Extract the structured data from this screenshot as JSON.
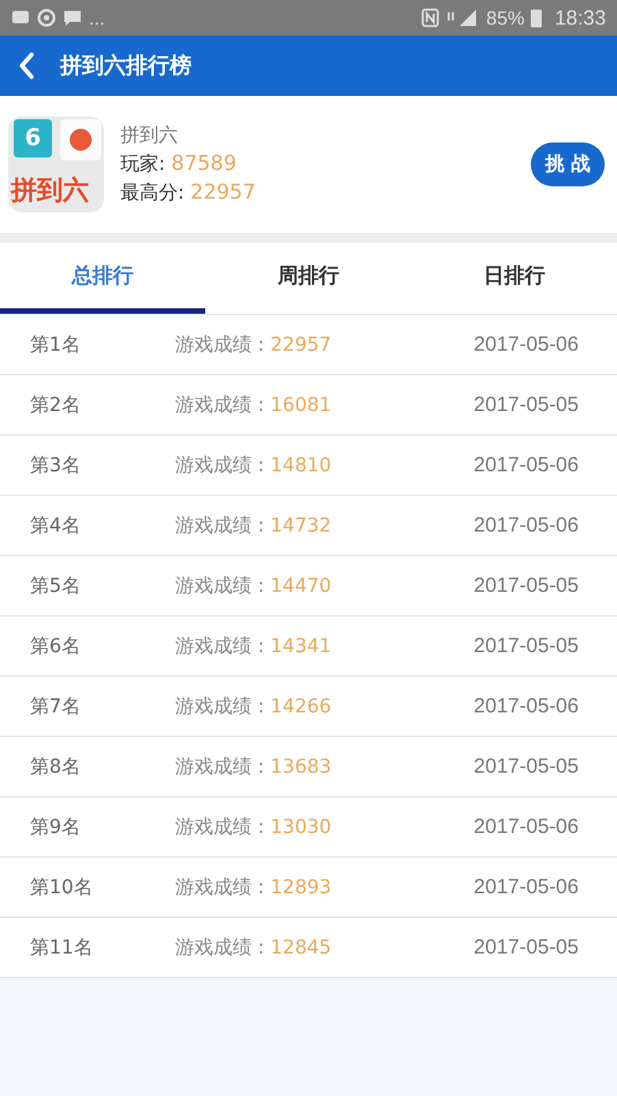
{
  "status_bar": {
    "more": "...",
    "battery": "85%",
    "time": "18:33"
  },
  "header": {
    "title": "拼到六排行榜"
  },
  "game": {
    "icon_number": "6",
    "icon_title": "拼到六",
    "name": "拼到六",
    "players_label": "玩家: ",
    "players": "87589",
    "best_label": "最高分: ",
    "best": "22957",
    "button": "挑 战"
  },
  "tabs": [
    {
      "label": "总排行",
      "selected": true
    },
    {
      "label": "周排行",
      "selected": false
    },
    {
      "label": "日排行",
      "selected": false
    }
  ],
  "rows": [
    {
      "rank": "第1名",
      "label": "游戏成绩 : ",
      "score": "22957",
      "date": "2017-05-06"
    },
    {
      "rank": "第2名",
      "label": "游戏成绩 : ",
      "score": "16081",
      "date": "2017-05-05"
    },
    {
      "rank": "第3名",
      "label": "游戏成绩 : ",
      "score": "14810",
      "date": "2017-05-06"
    },
    {
      "rank": "第4名",
      "label": "游戏成绩 : ",
      "score": "14732",
      "date": "2017-05-06"
    },
    {
      "rank": "第5名",
      "label": "游戏成绩 : ",
      "score": "14470",
      "date": "2017-05-05"
    },
    {
      "rank": "第6名",
      "label": "游戏成绩 : ",
      "score": "14341",
      "date": "2017-05-05"
    },
    {
      "rank": "第7名",
      "label": "游戏成绩 : ",
      "score": "14266",
      "date": "2017-05-06"
    },
    {
      "rank": "第8名",
      "label": "游戏成绩 : ",
      "score": "13683",
      "date": "2017-05-05"
    },
    {
      "rank": "第9名",
      "label": "游戏成绩 : ",
      "score": "13030",
      "date": "2017-05-06"
    },
    {
      "rank": "第10名",
      "label": "游戏成绩 : ",
      "score": "12893",
      "date": "2017-05-06"
    },
    {
      "rank": "第11名",
      "label": "游戏成绩 : ",
      "score": "12845",
      "date": "2017-05-05"
    }
  ]
}
